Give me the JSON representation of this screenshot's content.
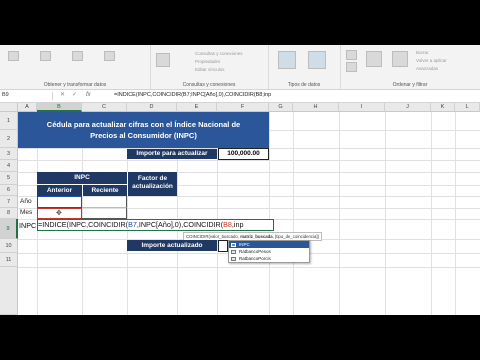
{
  "ribbon": {
    "groups": [
      {
        "label": "Obtener y transformar datos",
        "items": [
          "",
          "",
          ""
        ]
      },
      {
        "label": "Consultas y conexiones",
        "items": [
          "Consultas y conexiones",
          "Propiedades",
          "Editar vínculos"
        ]
      },
      {
        "label": "Tipos de datos",
        "items": [
          "",
          ""
        ]
      },
      {
        "label": "Ordenar y filtrar",
        "items": [
          "Borrar",
          "Volver a aplicar",
          "Avanzadas"
        ]
      }
    ]
  },
  "formula_bar": {
    "name_box": "B9",
    "fx": "fx",
    "formula": "=INDICE(INPC,COINCIDIR(B7;INPC[Año],0),COINCIDIR(B8;inp"
  },
  "columns": [
    "A",
    "B",
    "C",
    "D",
    "E",
    "F",
    "G",
    "H",
    "I",
    "J",
    "K",
    "L"
  ],
  "rows": [
    "1",
    "2",
    "3",
    "4",
    "5",
    "6",
    "7",
    "8",
    "9",
    "10",
    "11"
  ],
  "sheet": {
    "title_line1": "Cédula para actualizar cifras con el Índice Nacional de",
    "title_line2": "Precios al Consumidor (INPC)",
    "importe_label": "Importe para actualizar",
    "importe_value": "100,000.00",
    "inpc_header": "INPC",
    "factor_header_line1": "Factor de",
    "factor_header_line2": "actualización",
    "anterior": "Anterior",
    "reciente": "Reciente",
    "anio": "Año",
    "mes": "Mes",
    "inpc_row": "INPC",
    "edit_prefix": "=INDICE(INPC,COINCIDIR(",
    "edit_ref1": "B7",
    "edit_mid": ",INPC[Año],0),COINCIDIR(",
    "edit_ref2": "B8",
    "edit_suffix": ",inp",
    "importe_actualizado": "Importe actualizado"
  },
  "tooltip": {
    "fn": "COINCIDIR(",
    "arg1": "valor_buscado",
    "arg2": "matriz_buscada",
    "arg3": "[tipo_de_coincidencia])"
  },
  "autocomplete": {
    "items": [
      "INPC",
      "RatbancoPesos",
      "RatbancoPorcis"
    ],
    "selected_index": 0
  },
  "colors": {
    "title_bg": "#2b579a",
    "header_bg": "#1f3864",
    "ref1": "#1f4fb4",
    "ref2": "#c0392b",
    "excel_green": "#217346"
  }
}
